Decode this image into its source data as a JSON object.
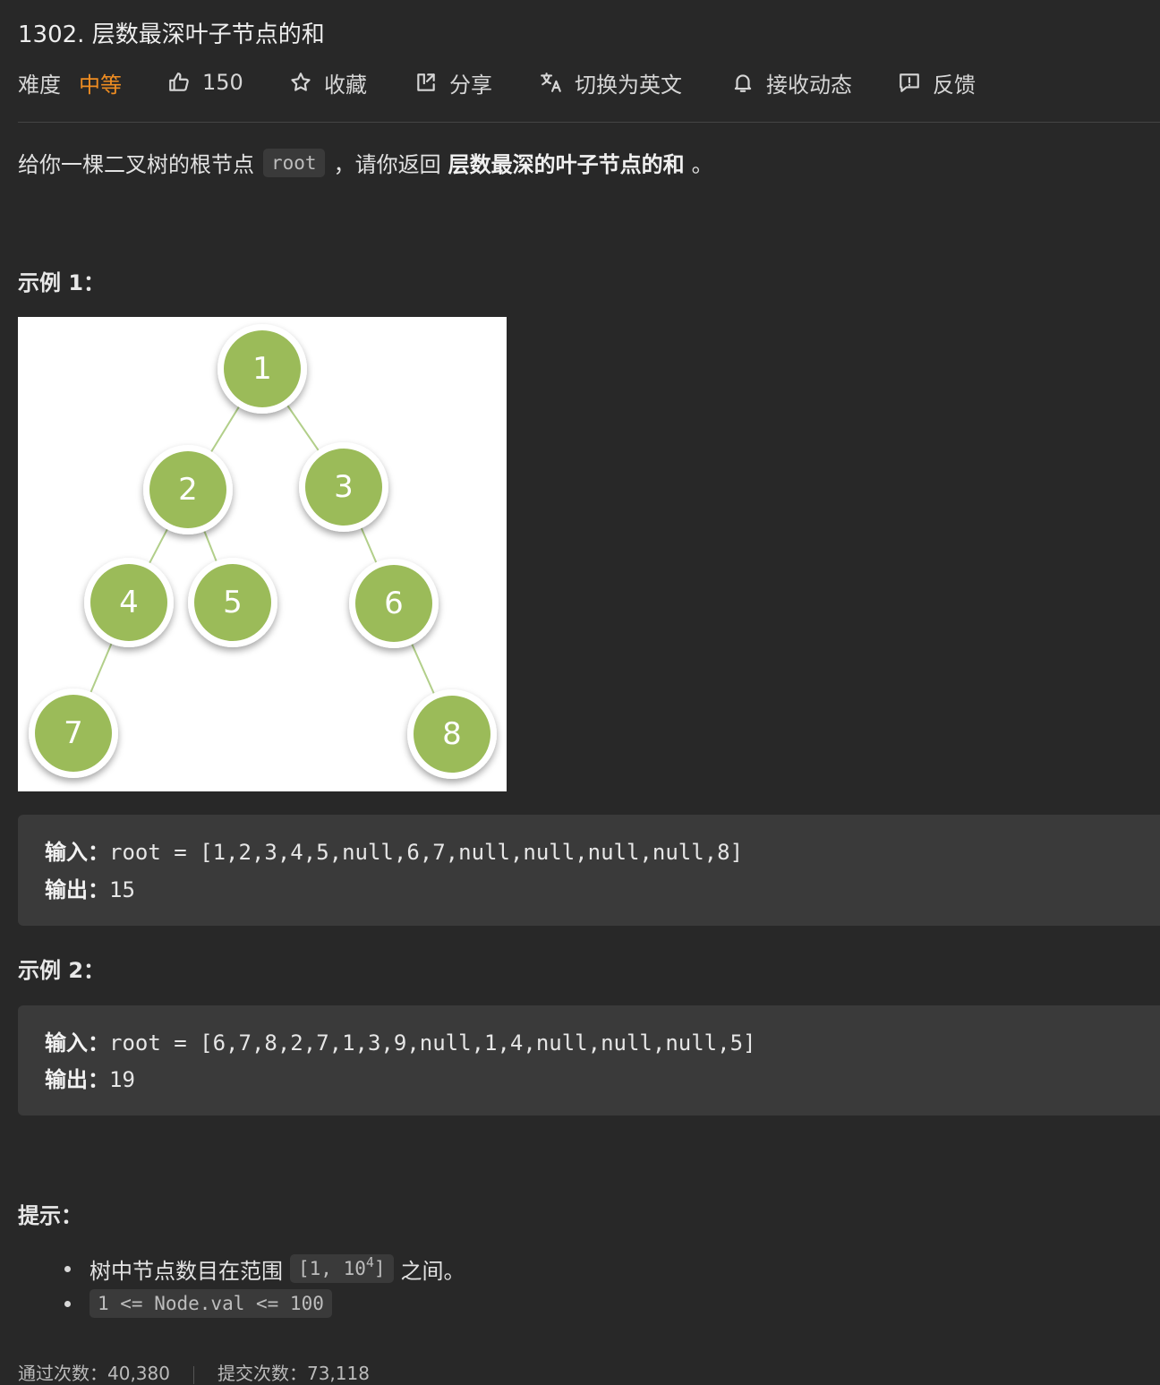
{
  "problem": {
    "title": "1302. 层数最深叶子节点的和"
  },
  "toolbar": {
    "difficulty_label": "难度",
    "difficulty_value": "中等",
    "difficulty_color": "#ef8d22",
    "likes": "150",
    "favorite": "收藏",
    "share": "分享",
    "switch_lang": "切换为英文",
    "subscribe": "接收动态",
    "feedback": "反馈",
    "icons": [
      "thumbs-up-icon",
      "star-icon",
      "share-icon",
      "translate-icon",
      "bell-icon",
      "feedback-icon"
    ]
  },
  "description": {
    "part1": "给你一棵二叉树的根节点",
    "code": "root",
    "part2": "，请你返回",
    "bold": "层数最深的叶子节点的和",
    "part3": "。"
  },
  "example1": {
    "heading": "示例 1：",
    "tree_nodes": [
      "1",
      "2",
      "3",
      "4",
      "5",
      "6",
      "7",
      "8"
    ],
    "input_label": "输入：",
    "input_value": "root = [1,2,3,4,5,null,6,7,null,null,null,null,8]",
    "output_label": "输出：",
    "output_value": "15"
  },
  "example2": {
    "heading": "示例 2：",
    "input_label": "输入：",
    "input_value": "root = [6,7,8,2,7,1,3,9,null,1,4,null,null,null,5]",
    "output_label": "输出：",
    "output_value": "19"
  },
  "tips": {
    "heading": "提示：",
    "item1_pre": "树中节点数目在范围",
    "item1_code_a": "[1, 10",
    "item1_sup": "4",
    "item1_code_b": "]",
    "item1_post": "之间。",
    "item2_code": "1 <= Node.val <= 100"
  },
  "footer": {
    "passed": "通过次数：40,380",
    "submitted": "提交次数：73,118"
  }
}
